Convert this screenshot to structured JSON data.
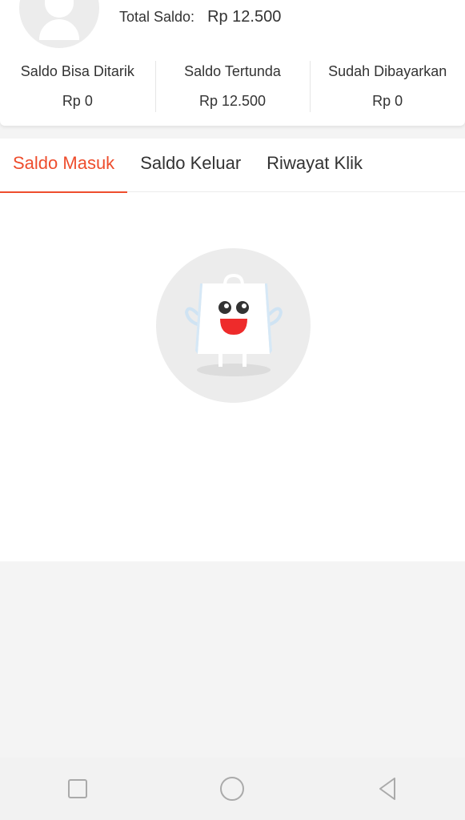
{
  "header": {
    "total_label": "Total Saldo:",
    "total_value": "Rp 12.500"
  },
  "stats": [
    {
      "label": "Saldo Bisa Ditarik",
      "value": "Rp 0"
    },
    {
      "label": "Saldo Tertunda",
      "value": "Rp 12.500"
    },
    {
      "label": "Sudah Dibayarkan",
      "value": "Rp 0"
    }
  ],
  "tabs": [
    {
      "label": "Saldo Masuk",
      "active": true
    },
    {
      "label": "Saldo Keluar",
      "active": false
    },
    {
      "label": "Riwayat Klik",
      "active": false
    }
  ],
  "colors": {
    "accent": "#ee4d2d",
    "mascot_red": "#ee2b2b",
    "background": "#f4f4f4"
  },
  "icons": {
    "avatar": "user-placeholder-icon",
    "empty_state": "shopping-bag-mascot-icon",
    "nav_recents": "square-icon",
    "nav_home": "circle-icon",
    "nav_back": "triangle-back-icon"
  }
}
